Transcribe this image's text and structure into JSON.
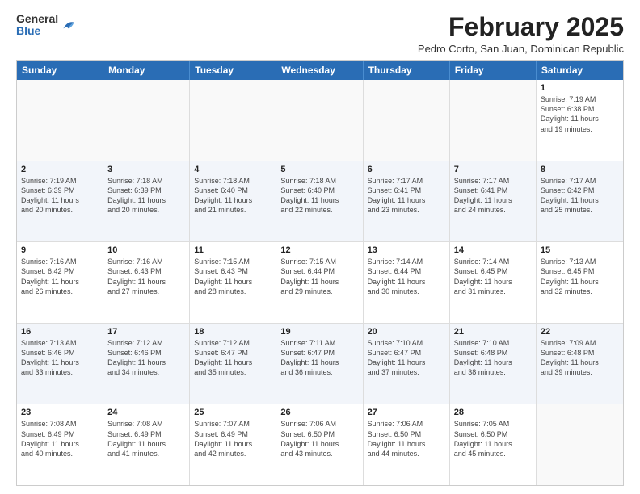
{
  "header": {
    "logo_line1": "General",
    "logo_line2": "Blue",
    "title": "February 2025",
    "subtitle": "Pedro Corto, San Juan, Dominican Republic"
  },
  "weekdays": [
    "Sunday",
    "Monday",
    "Tuesday",
    "Wednesday",
    "Thursday",
    "Friday",
    "Saturday"
  ],
  "weeks": [
    [
      {
        "day": "",
        "info": ""
      },
      {
        "day": "",
        "info": ""
      },
      {
        "day": "",
        "info": ""
      },
      {
        "day": "",
        "info": ""
      },
      {
        "day": "",
        "info": ""
      },
      {
        "day": "",
        "info": ""
      },
      {
        "day": "1",
        "info": "Sunrise: 7:19 AM\nSunset: 6:38 PM\nDaylight: 11 hours\nand 19 minutes."
      }
    ],
    [
      {
        "day": "2",
        "info": "Sunrise: 7:19 AM\nSunset: 6:39 PM\nDaylight: 11 hours\nand 20 minutes."
      },
      {
        "day": "3",
        "info": "Sunrise: 7:18 AM\nSunset: 6:39 PM\nDaylight: 11 hours\nand 20 minutes."
      },
      {
        "day": "4",
        "info": "Sunrise: 7:18 AM\nSunset: 6:40 PM\nDaylight: 11 hours\nand 21 minutes."
      },
      {
        "day": "5",
        "info": "Sunrise: 7:18 AM\nSunset: 6:40 PM\nDaylight: 11 hours\nand 22 minutes."
      },
      {
        "day": "6",
        "info": "Sunrise: 7:17 AM\nSunset: 6:41 PM\nDaylight: 11 hours\nand 23 minutes."
      },
      {
        "day": "7",
        "info": "Sunrise: 7:17 AM\nSunset: 6:41 PM\nDaylight: 11 hours\nand 24 minutes."
      },
      {
        "day": "8",
        "info": "Sunrise: 7:17 AM\nSunset: 6:42 PM\nDaylight: 11 hours\nand 25 minutes."
      }
    ],
    [
      {
        "day": "9",
        "info": "Sunrise: 7:16 AM\nSunset: 6:42 PM\nDaylight: 11 hours\nand 26 minutes."
      },
      {
        "day": "10",
        "info": "Sunrise: 7:16 AM\nSunset: 6:43 PM\nDaylight: 11 hours\nand 27 minutes."
      },
      {
        "day": "11",
        "info": "Sunrise: 7:15 AM\nSunset: 6:43 PM\nDaylight: 11 hours\nand 28 minutes."
      },
      {
        "day": "12",
        "info": "Sunrise: 7:15 AM\nSunset: 6:44 PM\nDaylight: 11 hours\nand 29 minutes."
      },
      {
        "day": "13",
        "info": "Sunrise: 7:14 AM\nSunset: 6:44 PM\nDaylight: 11 hours\nand 30 minutes."
      },
      {
        "day": "14",
        "info": "Sunrise: 7:14 AM\nSunset: 6:45 PM\nDaylight: 11 hours\nand 31 minutes."
      },
      {
        "day": "15",
        "info": "Sunrise: 7:13 AM\nSunset: 6:45 PM\nDaylight: 11 hours\nand 32 minutes."
      }
    ],
    [
      {
        "day": "16",
        "info": "Sunrise: 7:13 AM\nSunset: 6:46 PM\nDaylight: 11 hours\nand 33 minutes."
      },
      {
        "day": "17",
        "info": "Sunrise: 7:12 AM\nSunset: 6:46 PM\nDaylight: 11 hours\nand 34 minutes."
      },
      {
        "day": "18",
        "info": "Sunrise: 7:12 AM\nSunset: 6:47 PM\nDaylight: 11 hours\nand 35 minutes."
      },
      {
        "day": "19",
        "info": "Sunrise: 7:11 AM\nSunset: 6:47 PM\nDaylight: 11 hours\nand 36 minutes."
      },
      {
        "day": "20",
        "info": "Sunrise: 7:10 AM\nSunset: 6:47 PM\nDaylight: 11 hours\nand 37 minutes."
      },
      {
        "day": "21",
        "info": "Sunrise: 7:10 AM\nSunset: 6:48 PM\nDaylight: 11 hours\nand 38 minutes."
      },
      {
        "day": "22",
        "info": "Sunrise: 7:09 AM\nSunset: 6:48 PM\nDaylight: 11 hours\nand 39 minutes."
      }
    ],
    [
      {
        "day": "23",
        "info": "Sunrise: 7:08 AM\nSunset: 6:49 PM\nDaylight: 11 hours\nand 40 minutes."
      },
      {
        "day": "24",
        "info": "Sunrise: 7:08 AM\nSunset: 6:49 PM\nDaylight: 11 hours\nand 41 minutes."
      },
      {
        "day": "25",
        "info": "Sunrise: 7:07 AM\nSunset: 6:49 PM\nDaylight: 11 hours\nand 42 minutes."
      },
      {
        "day": "26",
        "info": "Sunrise: 7:06 AM\nSunset: 6:50 PM\nDaylight: 11 hours\nand 43 minutes."
      },
      {
        "day": "27",
        "info": "Sunrise: 7:06 AM\nSunset: 6:50 PM\nDaylight: 11 hours\nand 44 minutes."
      },
      {
        "day": "28",
        "info": "Sunrise: 7:05 AM\nSunset: 6:50 PM\nDaylight: 11 hours\nand 45 minutes."
      },
      {
        "day": "",
        "info": ""
      }
    ]
  ]
}
